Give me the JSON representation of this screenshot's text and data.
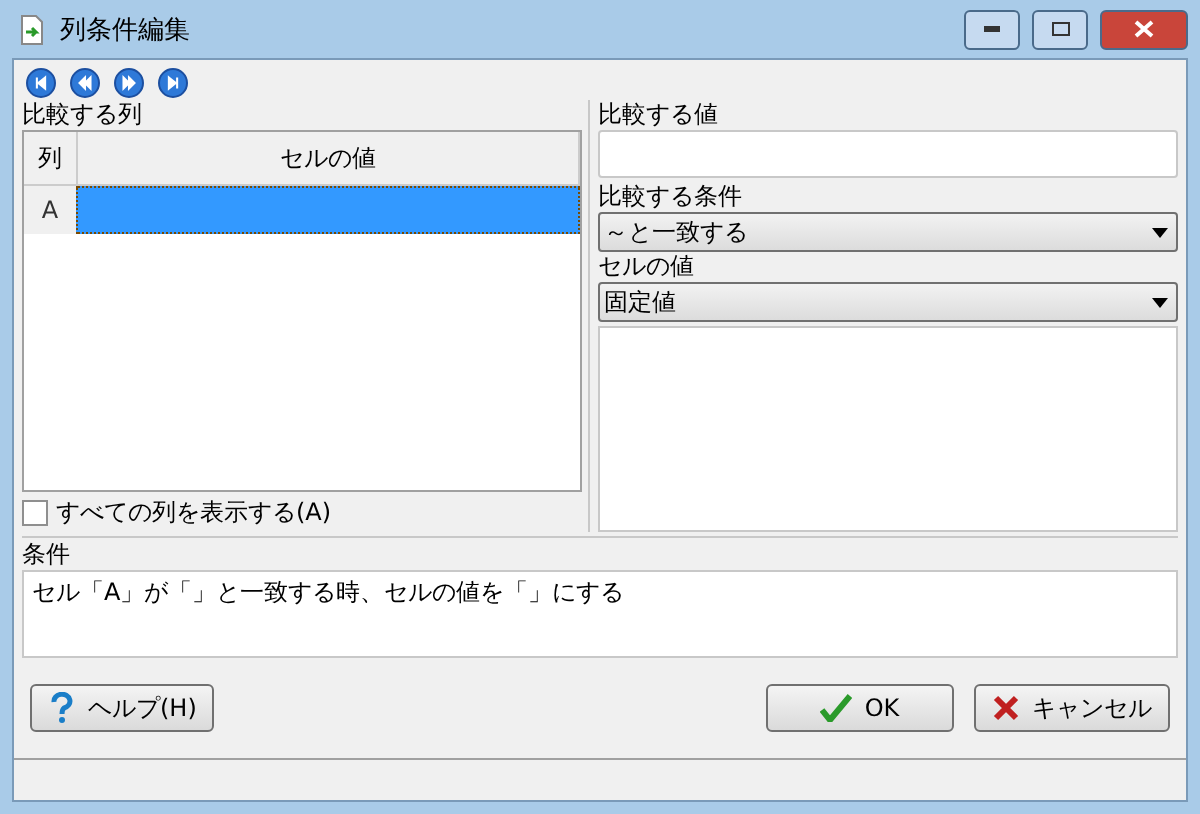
{
  "window": {
    "title": "列条件編集"
  },
  "nav_buttons": [
    {
      "kind": "first"
    },
    {
      "kind": "prev"
    },
    {
      "kind": "next"
    },
    {
      "kind": "last"
    }
  ],
  "compare_column": {
    "label": "比較する列",
    "columns": [
      "列",
      "セルの値"
    ],
    "rows": [
      {
        "header": "A",
        "selected": true
      }
    ]
  },
  "show_all": {
    "label": "すべての列を表示する(A)",
    "checked": false
  },
  "compare_value": {
    "label": "比較する値"
  },
  "compare_condition": {
    "label": "比較する条件",
    "value": "～と一致する"
  },
  "cell_value": {
    "label": "セルの値",
    "value": "固定値"
  },
  "condition": {
    "label": "条件",
    "text": "セル「A」が「」と一致する時、セルの値を「」にする"
  },
  "buttons": [
    {
      "kind": "help",
      "label": "ヘルプ(H)"
    },
    {
      "kind": "ok",
      "label": "OK"
    },
    {
      "kind": "cancel",
      "label": "キャンセル"
    }
  ]
}
